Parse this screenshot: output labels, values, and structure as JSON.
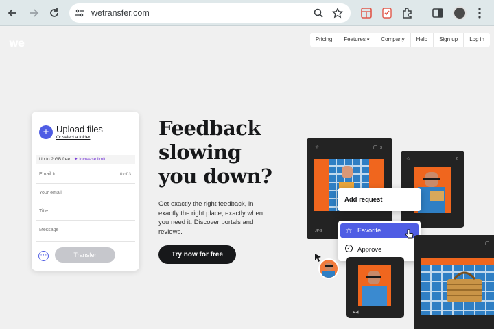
{
  "browser": {
    "url": "wetransfer.com"
  },
  "site": {
    "logo": "we",
    "nav": {
      "items": [
        "Pricing",
        "Features",
        "Company",
        "Help",
        "Sign up",
        "Log in"
      ]
    }
  },
  "upload_card": {
    "title": "Upload files",
    "select_folder": "Or select a folder",
    "limit_text": "Up to 2 GB free",
    "increase_limit": "Increase limit",
    "email_to_placeholder": "Email to",
    "email_count": "0 of 3",
    "your_email_placeholder": "Your email",
    "title_placeholder": "Title",
    "message_placeholder": "Message",
    "transfer_label": "Transfer"
  },
  "hero": {
    "title_line1": "Feedback",
    "title_line2": "slowing",
    "title_line3": "you down?",
    "subtitle": "Get exactly the right feedback, in exactly the right place, exactly when you need it. Discover portals and reviews.",
    "cta": "Try now for free"
  },
  "mockup": {
    "panel1_count": "3",
    "panel1_format": "JPG",
    "panel2_count": "2",
    "add_request": "Add request",
    "favorite": "Favorite",
    "approve": "Approve",
    "colors": {
      "accent": "#4f5de4",
      "orange": "#f0661e",
      "dark": "#232323"
    }
  }
}
